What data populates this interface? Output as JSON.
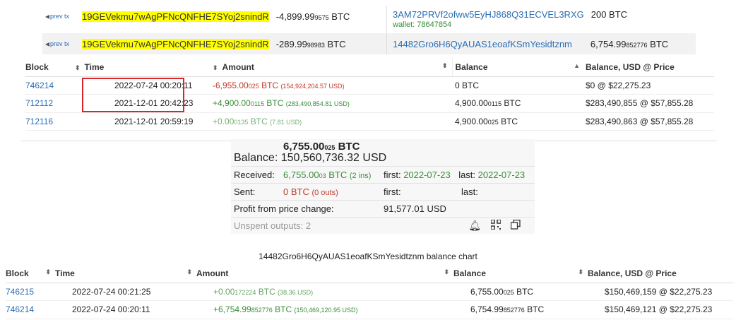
{
  "inputs": [
    {
      "prev": "prev tx",
      "address": "19GEVekmu7wAgPFNcQNFHE7SYoj2snindR",
      "amount_main": "-4,899.99",
      "amount_small": "9575",
      "unit": "BTC"
    },
    {
      "prev": "prev tx",
      "address": "19GEVekmu7wAgPFNcQNFHE7SYoj2snindR",
      "amount_main": "-289.99",
      "amount_small": "98983",
      "unit": "BTC"
    }
  ],
  "outputs": [
    {
      "address": "3AM72PRVf2ofww5EyHJ868Q31ECVEL3RXG",
      "wallet": "wallet: 78647854",
      "amount": "200 BTC"
    },
    {
      "address": "14482Gro6H6QyAUAS1eoafKSmYesidtznm",
      "amount_main": "6,754.99",
      "amount_small": "852776",
      "unit": "BTC"
    }
  ],
  "table1": {
    "headers": [
      "Block",
      "Time",
      "Amount",
      "Balance",
      "Balance, USD @ Price"
    ],
    "rows": [
      {
        "block": "746214",
        "time": "2022-07-24 00:20:11",
        "amt_main": "-6,955.00",
        "amt_small": "025",
        "amt_unit": "BTC",
        "amt_usd": "(154,924,204.57 USD)",
        "balance": "0 BTC",
        "balance_usd": "$0 @ $22,275.23"
      },
      {
        "block": "712112",
        "time": "2021-12-01 20:42:23",
        "amt_main": "+4,900.00",
        "amt_small": "0115",
        "amt_unit": "BTC",
        "amt_usd": "(283,490,854.81 USD)",
        "bal_main": "4,900.00",
        "bal_small": "0115",
        "bal_unit": "BTC",
        "balance_usd": "$283,490,855 @ $57,855.28"
      },
      {
        "block": "712116",
        "time": "2021-12-01 20:59:19",
        "amt_main": "+0.00",
        "amt_small": "0135",
        "amt_unit": "BTC",
        "amt_usd": "(7.81 USD)",
        "bal_main": "4,900.00",
        "bal_small": "025",
        "bal_unit": "BTC",
        "balance_usd": "$283,490,863 @ $57,855.28"
      }
    ]
  },
  "summary": {
    "btc_main": "6,755.00",
    "btc_small": "025",
    "btc_unit": "BTC",
    "balance_label": "Balance:",
    "balance_usd": "150,560,736.32 USD",
    "received_label": "Received:",
    "received_main": "6,755.00",
    "received_small": "03",
    "received_unit": "BTC",
    "received_ins": "(2 ins)",
    "first_label": "first:",
    "received_first": "2022-07-23",
    "last_label": "last:",
    "received_last": "2022-07-23",
    "sent_label": "Sent:",
    "sent_value": "0 BTC",
    "sent_outs": "(0 outs)",
    "profit_label": "Profit from price change:",
    "profit_value": "91,577.01 USD",
    "unspent": "Unspent outputs: 2"
  },
  "chart_caption": "14482Gro6H6QyAUAS1eoafKSmYesidtznm balance chart",
  "table2": {
    "headers": [
      "Block",
      "Time",
      "Amount",
      "Balance",
      "Balance, USD @ Price"
    ],
    "rows": [
      {
        "block": "746215",
        "time": "2022-07-24 00:21:25",
        "amt_main": "+0.00",
        "amt_small": "172224",
        "amt_unit": "BTC",
        "amt_usd": "(38.36 USD)",
        "bal_main": "6,755.00",
        "bal_small": "025",
        "bal_unit": "BTC",
        "balance_usd": "$150,469,159 @ $22,275.23"
      },
      {
        "block": "746214",
        "time": "2022-07-24 00:20:11",
        "amt_main": "+6,754.99",
        "amt_small": "852776",
        "amt_unit": "BTC",
        "amt_usd": "(150,469,120.95 USD)",
        "bal_main": "6,754.99",
        "bal_small": "852776",
        "bal_unit": "BTC",
        "balance_usd": "$150,469,121 @ $22,275.23"
      }
    ]
  }
}
